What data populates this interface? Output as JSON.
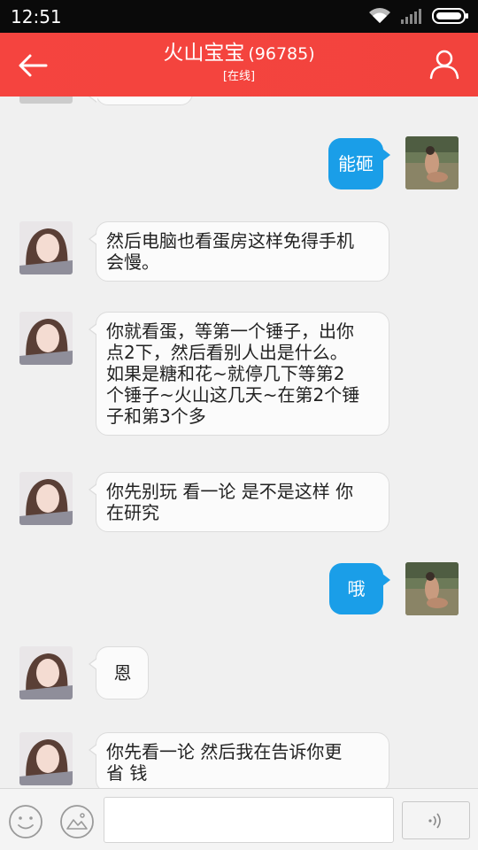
{
  "status_bar": {
    "time": "12:51"
  },
  "header": {
    "title": "火山宝宝",
    "id": "(96785)",
    "status": "[在线]"
  },
  "messages": [
    {
      "side": "right",
      "text": "能砸",
      "avatar": "contact-photo-sitting-figure"
    },
    {
      "side": "left",
      "lines": [
        "然后电脑也看蛋房这样免得手机",
        "会慢。"
      ],
      "avatar": "girl-selfie"
    },
    {
      "side": "left",
      "lines": [
        "你就看蛋，等第一个锤子，出你",
        "点2下，然后看别人出是什么。",
        "如果是糖和花~就停几下等第2",
        "个锤子~火山这几天~在第2个锤",
        "子和第3个多"
      ],
      "avatar": "girl-selfie"
    },
    {
      "side": "left",
      "lines": [
        "你先别玩 看一论 是不是这样 你",
        "在研究"
      ],
      "avatar": "girl-selfie"
    },
    {
      "side": "right",
      "text": "哦",
      "avatar": "contact-photo-sitting-figure"
    },
    {
      "side": "left",
      "lines": [
        "恩"
      ],
      "avatar": "girl-selfie"
    },
    {
      "side": "left",
      "lines": [
        "你先看一论 然后我在告诉你更",
        "省 钱"
      ],
      "avatar": "girl-selfie"
    }
  ],
  "input_bar": {
    "message_value": "",
    "icons": [
      "emoji-icon",
      "image-icon",
      "voice-icon"
    ]
  },
  "colors": {
    "header": "#f5443f",
    "outgoing_bubble": "#1a9ee8",
    "incoming_bubble": "#fbfbfb"
  }
}
